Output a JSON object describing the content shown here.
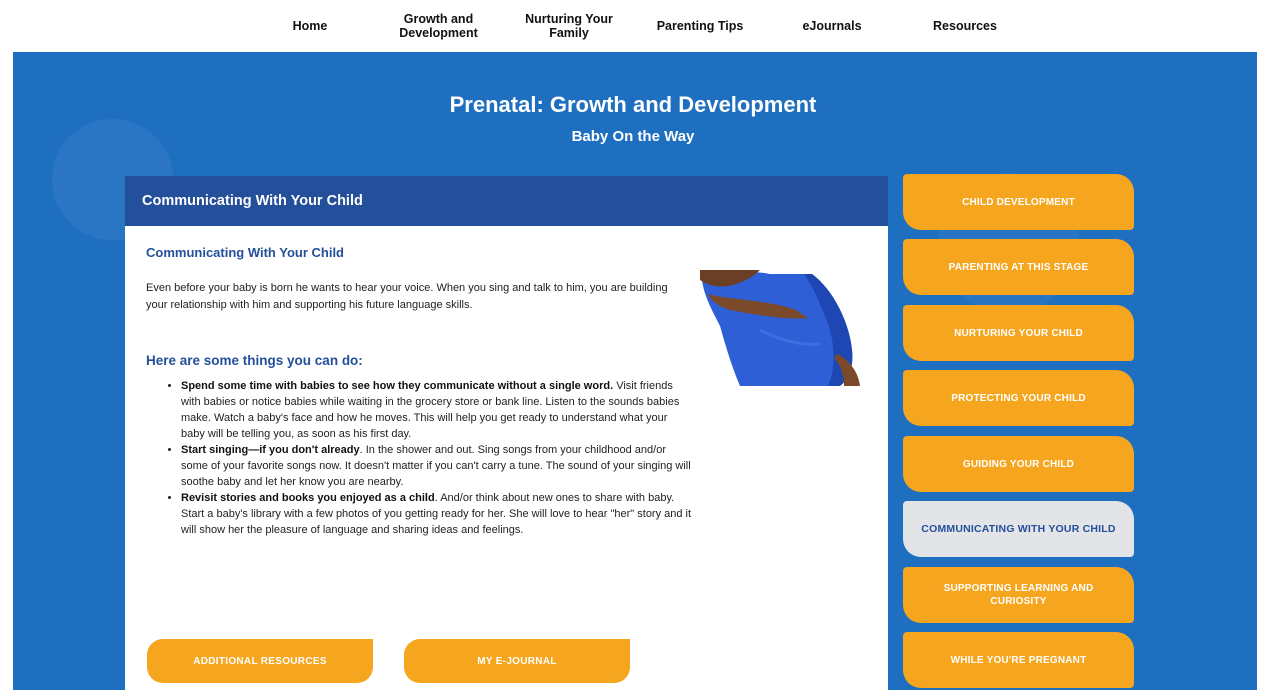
{
  "nav": {
    "items": [
      {
        "label": "Home"
      },
      {
        "label": "Growth and Development"
      },
      {
        "label": "Nurturing Your Family"
      },
      {
        "label": "Parenting Tips"
      },
      {
        "label": "eJournals"
      },
      {
        "label": "Resources"
      }
    ]
  },
  "hero": {
    "title": "Prenatal: Growth and Development",
    "subtitle": "Baby On the Way"
  },
  "card": {
    "header": "Communicating With Your Child",
    "heading": "Communicating With Your Child",
    "intro": "Even before your baby is born he wants to hear your voice. When you sing and talk to him, you are building your relationship with him and supporting his future language skills.",
    "things_heading": "Here are some things you can do:",
    "tips": [
      {
        "bold": "Spend some time with babies to see how they communicate without a single word.",
        "text": " Visit friends with babies or notice babies while waiting in the grocery store or bank line. Listen to the sounds babies make. Watch a baby's face and how he moves. This will help you get ready to understand what your baby will be telling you, as soon as his first day."
      },
      {
        "bold": "Start singing—if you don't already",
        "text": ". In the shower and out. Sing songs from your childhood and/or some of your favorite songs now. It doesn't matter if you can't carry a tune. The sound of your singing will soothe baby and let her know you are nearby."
      },
      {
        "bold": "Revisit stories and books you enjoyed as a child",
        "text": ". And/or think about new ones to share with baby. Start a baby's library with a few photos of you getting ready for her. She will love to hear \"her\" story and it will show her the pleasure of language and sharing ideas and feelings."
      }
    ],
    "buttons": {
      "additional": "ADDITIONAL RESOURCES",
      "journal": "MY E-JOURNAL"
    }
  },
  "sidebar": {
    "items": [
      {
        "label": "CHILD DEVELOPMENT"
      },
      {
        "label": "PARENTING AT THIS STAGE"
      },
      {
        "label": "NURTURING YOUR CHILD"
      },
      {
        "label": "PROTECTING YOUR CHILD"
      },
      {
        "label": "GUIDING YOUR CHILD"
      },
      {
        "label": "COMMUNICATING WITH YOUR CHILD"
      },
      {
        "label": "SUPPORTING LEARNING AND CURIOSITY"
      },
      {
        "label": "WHILE YOU'RE PREGNANT"
      }
    ],
    "active_index": 5
  },
  "colors": {
    "hero_blue": "#1f6fc1",
    "header_navy": "#244f9a",
    "accent_orange": "#f5a51e",
    "active_gray": "#e2e4e8"
  }
}
